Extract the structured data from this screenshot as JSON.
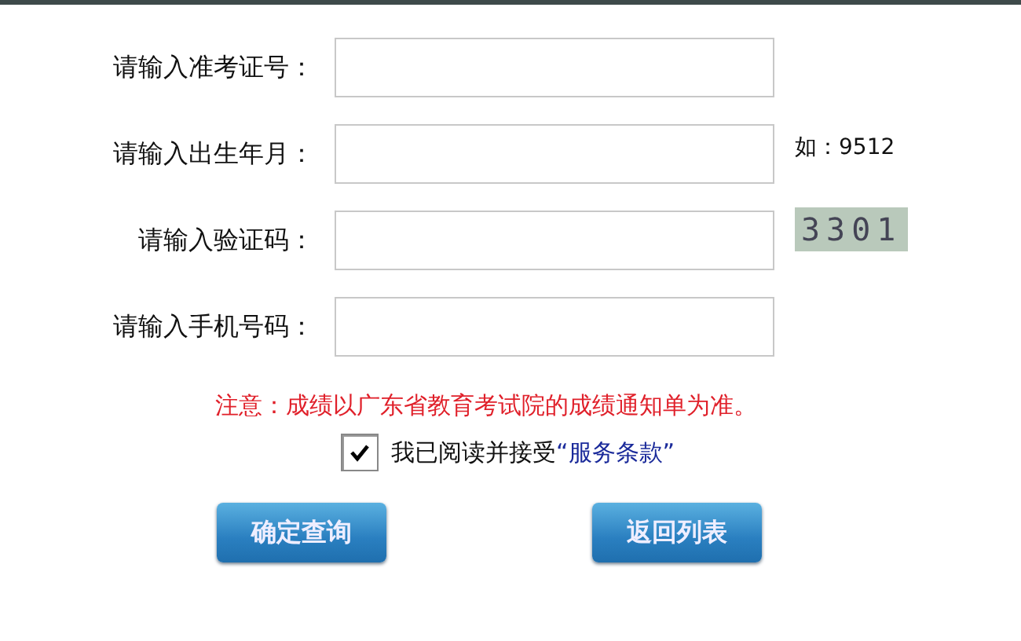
{
  "fields": [
    {
      "label": "请输入准考证号："
    },
    {
      "label": "请输入出生年月：",
      "hint": "如：9512"
    },
    {
      "label": "请输入验证码：",
      "captcha": "3301"
    },
    {
      "label": "请输入手机号码："
    }
  ],
  "notice": "注意：成绩以广东省教育考试院的成绩通知单为准。",
  "agreement": {
    "checked": true,
    "text": "我已阅读并接受",
    "link": "“服务条款”"
  },
  "buttons": [
    "确定查询",
    "返回列表"
  ]
}
